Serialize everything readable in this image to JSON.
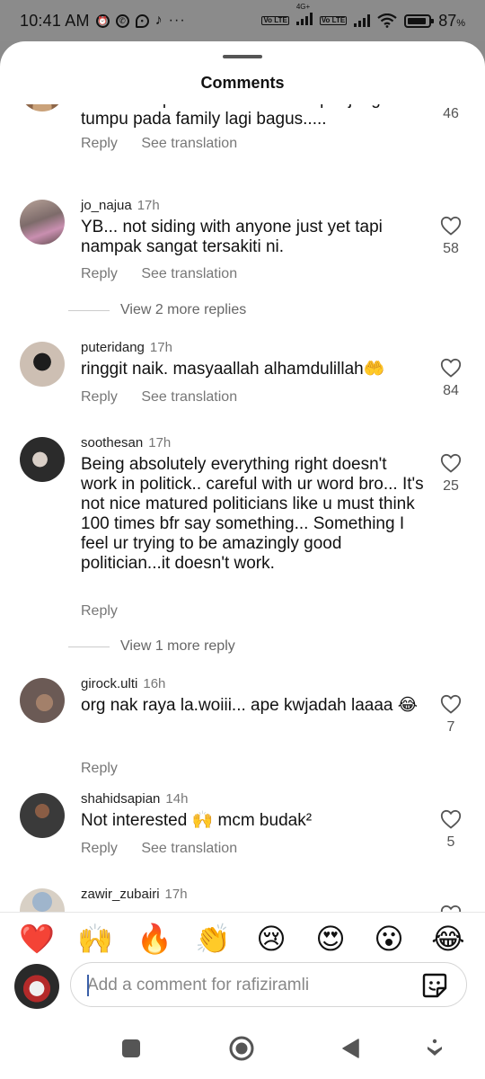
{
  "status_bar": {
    "time": "10:41 AM",
    "network": "4G+",
    "volte1": "Vo LTE",
    "volte2": "Vo LTE",
    "battery": "87",
    "battery_unit": "%"
  },
  "sheet": {
    "title": "Comments"
  },
  "comments": [
    {
      "username": "",
      "time": "",
      "text": "Nak bulan puasa dah ni......cuti panjang tumpu pada family lagi bagus.....",
      "reply": "Reply",
      "see_translation": "See translation",
      "likes": "46"
    },
    {
      "username": "jo_najua",
      "time": "17h",
      "text": "YB... not siding with anyone just yet tapi nampak sangat tersakiti ni.",
      "reply": "Reply",
      "see_translation": "See translation",
      "likes": "58"
    },
    {
      "username": "puteridang",
      "time": "17h",
      "text": "ringgit naik. masyaallah alhamdulillah🤲",
      "reply": "Reply",
      "see_translation": "See translation",
      "likes": "84"
    },
    {
      "username": "soothesan",
      "time": "17h",
      "text": "Being absolutely everything right doesn't work in politick.. careful with ur word bro... It's not nice matured politicians like u must think 100 times bfr say something... Something I feel ur trying to be amazingly good politician...it doesn't work.",
      "reply": "Reply",
      "likes": "25"
    },
    {
      "username": "girock.ulti",
      "time": "16h",
      "text": "org nak raya la.woiii... ape kwjadah laaaa 😂",
      "reply": "Reply",
      "likes": "7"
    },
    {
      "username": "shahidsapian",
      "time": "14h",
      "text": "Not interested 🙌 mcm budak²",
      "reply": "Reply",
      "see_translation": "See translation",
      "likes": "5"
    },
    {
      "username": "zawir_zubairi",
      "time": "17h"
    }
  ],
  "view_replies": [
    {
      "label": "View 2 more replies"
    },
    {
      "label": "View 1 more reply"
    }
  ],
  "reactions": [
    "❤️",
    "🙌",
    "🔥",
    "👏",
    "😢",
    "😍",
    "😮",
    "😂"
  ],
  "composer": {
    "placeholder": "Add a comment for rafiziramli"
  },
  "colors": {
    "accent_caret": "#3a5fa8",
    "heart": "#e0293a",
    "status_bar_bg": "#8b8b8b"
  },
  "icons": {
    "like": "heart-outline-icon",
    "sticker": "sticker-icon",
    "nav_recents": "square-icon",
    "nav_home": "circle-icon",
    "nav_back": "triangle-back-icon",
    "nav_menu": "down-arrow-icon"
  }
}
